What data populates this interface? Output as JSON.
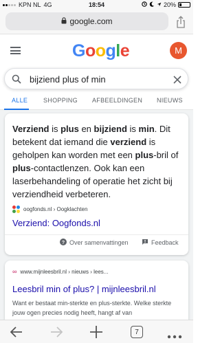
{
  "status_bar": {
    "carrier": "KPN NL",
    "network": "4G",
    "time": "18:54",
    "battery_percent": "20%",
    "battery_level": 0.2
  },
  "browser": {
    "url": "google.com",
    "tab_count": "7"
  },
  "header": {
    "logo_letters": [
      {
        "char": "G",
        "color": "#4285F4"
      },
      {
        "char": "o",
        "color": "#EA4335"
      },
      {
        "char": "o",
        "color": "#FBBC05"
      },
      {
        "char": "g",
        "color": "#4285F4"
      },
      {
        "char": "l",
        "color": "#34A853"
      },
      {
        "char": "e",
        "color": "#EA4335"
      }
    ],
    "avatar_letter": "M"
  },
  "search": {
    "query": "bijziend plus of min"
  },
  "tabs": [
    {
      "label": "ALLE",
      "active": true
    },
    {
      "label": "SHOPPING",
      "active": false
    },
    {
      "label": "AFBEELDINGEN",
      "active": false
    },
    {
      "label": "NIEUWS",
      "active": false
    }
  ],
  "featured_snippet": {
    "segments": [
      {
        "text": "Verziend",
        "bold": true
      },
      {
        "text": " is ",
        "bold": false
      },
      {
        "text": "plus",
        "bold": true
      },
      {
        "text": " en ",
        "bold": false
      },
      {
        "text": "bijziend",
        "bold": true
      },
      {
        "text": " is ",
        "bold": false
      },
      {
        "text": "min",
        "bold": true
      },
      {
        "text": ". Dit betekent dat iemand die ",
        "bold": false
      },
      {
        "text": "verziend",
        "bold": true
      },
      {
        "text": " is geholpen kan worden met een ",
        "bold": false
      },
      {
        "text": "plus",
        "bold": true
      },
      {
        "text": "-bril of ",
        "bold": false
      },
      {
        "text": "plus",
        "bold": true
      },
      {
        "text": "-contactlenzen. Ook kan een laserbehandeling of operatie het zicht bij verziendheid verbeteren.",
        "bold": false
      }
    ],
    "source": "oogfonds.nl › Oogklachten",
    "link_title": "Verziend: Oogfonds.nl",
    "about_label": "Over samenvattingen",
    "feedback_label": "Feedback"
  },
  "result2": {
    "source": "www.mijnleesbril.nl › nieuws › lees...",
    "title": "Leesbril min of plus? | mijnleesbril.nl",
    "description": "Want er bestaat min-sterkte en plus-sterkte. Welke sterkte jouw ogen precies nodig heeft, hangt af van"
  },
  "colors": {
    "link_blue": "#1a0dab",
    "tab_active": "#1a73e8",
    "avatar_bg": "#e8572f"
  }
}
